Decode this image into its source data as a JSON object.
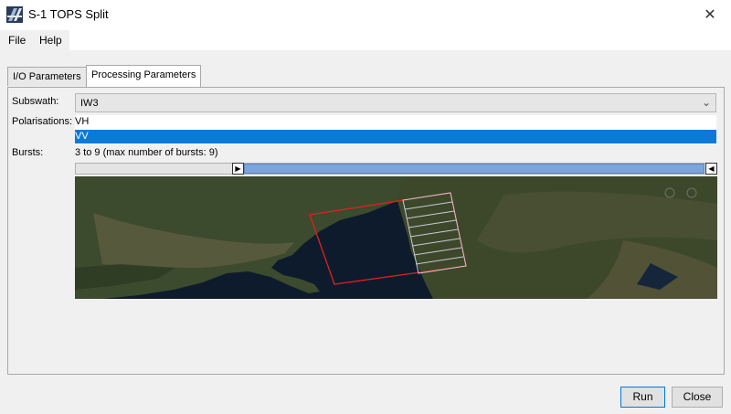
{
  "window": {
    "title": "S-1 TOPS Split",
    "close_glyph": "✕"
  },
  "menu": {
    "items": [
      "File",
      "Help"
    ]
  },
  "tabs": [
    {
      "label": "I/O Parameters",
      "active": false
    },
    {
      "label": "Processing Parameters",
      "active": true
    }
  ],
  "subswath": {
    "label": "Subswath:",
    "value": "IW3"
  },
  "polarisations": {
    "label": "Polarisations:",
    "options": [
      "VH",
      "VV"
    ],
    "selected": "VV"
  },
  "bursts": {
    "label": "Bursts:",
    "text": "3 to 9 (max number of bursts: 9)",
    "min": 3,
    "max": 9,
    "total": 9
  },
  "buttons": {
    "run": "Run",
    "close": "Close"
  },
  "colors": {
    "accent": "#0a7ad6",
    "footprint": "#e0201e",
    "burst_lines": "#c9c9d6"
  },
  "icons": {
    "app": "satellite-icon",
    "close": "close-icon",
    "dropdown": "chevron-down-icon"
  }
}
